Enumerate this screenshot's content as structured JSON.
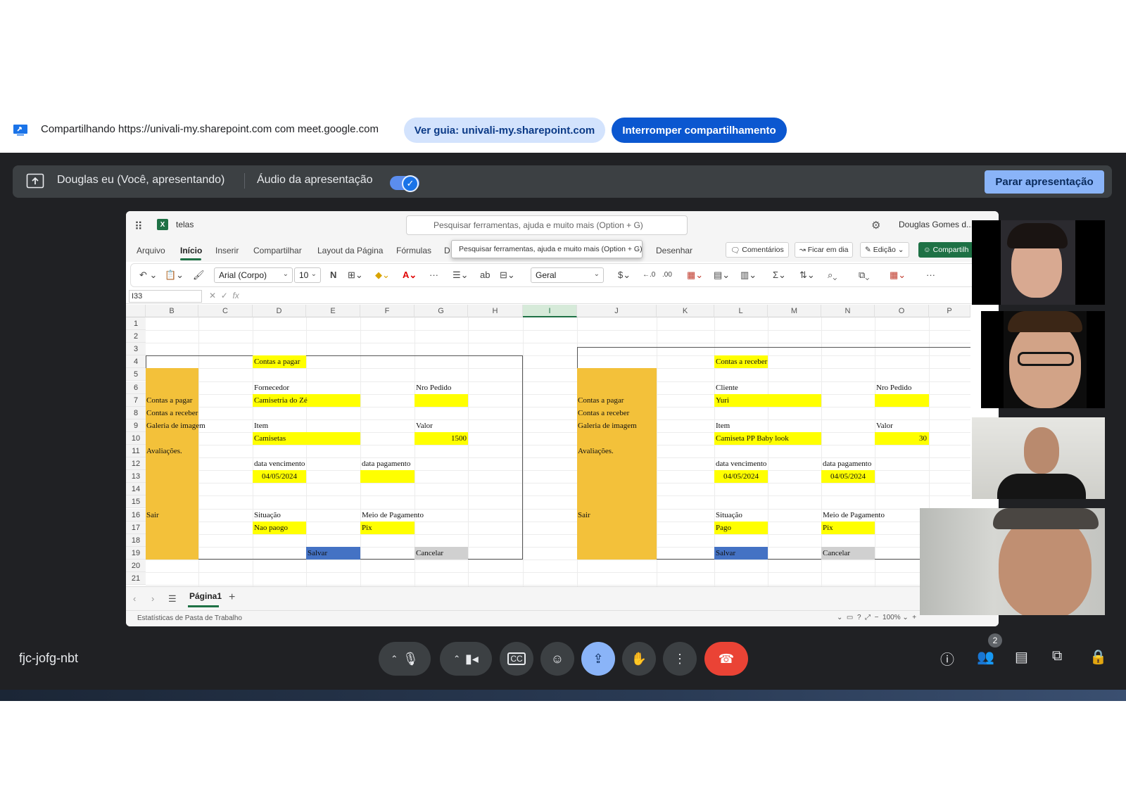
{
  "share_bar": {
    "text": "Compartilhando https://univali-my.sharepoint.com com meet.google.com",
    "guide_button": "Ver guia: univali-my.sharepoint.com",
    "stop_button": "Interromper compartilhamento"
  },
  "present_bar": {
    "presenter": "Douglas eu (Você, apresentando)",
    "audio_label": "Áudio da apresentação",
    "audio_enabled": true,
    "stop_button": "Parar apresentação"
  },
  "excel": {
    "filename": "telas",
    "search_placeholder": "Pesquisar ferramentas, ajuda e muito mais (Option + G)",
    "user": "Douglas Gomes d...",
    "menu": [
      "Arquivo",
      "Início",
      "Inserir",
      "Compartilhar",
      "Layout da Página",
      "Fórmulas",
      "D",
      "Desenhar"
    ],
    "tooltip": "Pesquisar ferramentas, ajuda e muito mais (Option + G)",
    "pills": {
      "comments": "Comentários",
      "catchup": "Ficar em dia",
      "editing": "Edição",
      "share": "Compartilh"
    },
    "ribbon": {
      "font": "Arial (Corpo)",
      "size": "10",
      "bold": "N",
      "format": "Geral",
      "currency": "$"
    },
    "name_box": "I33",
    "columns": [
      "B",
      "C",
      "D",
      "E",
      "F",
      "G",
      "H",
      "I",
      "J",
      "K",
      "L",
      "M",
      "N",
      "O",
      "P"
    ],
    "rows": [
      "1",
      "2",
      "3",
      "4",
      "5",
      "6",
      "7",
      "8",
      "9",
      "10",
      "11",
      "12",
      "13",
      "14",
      "15",
      "16",
      "17",
      "18",
      "19",
      "20",
      "21"
    ],
    "left_form": {
      "title": "Contas a pagar",
      "menu": [
        "Contas a pagar",
        "Contas a receber",
        "Galeria de imagem",
        "Avaliações.",
        "Sair"
      ],
      "fornecedor_label": "Fornecedor",
      "fornecedor_value": "Camisetria do Zé",
      "pedido_label": "Nro Pedido",
      "item_label": "Item",
      "item_value": "Camisetas",
      "valor_label": "Valor",
      "valor_value": "1500",
      "venc_label": "data vencimento",
      "venc_value": "04/05/2024",
      "pag_label": "data pagamento",
      "situacao_label": "Situação",
      "situacao_value": "Nao paogo",
      "meio_label": "Meio de Pagamento",
      "meio_value": "Pix",
      "save": "Salvar",
      "cancel": "Cancelar"
    },
    "right_form": {
      "title": "Contas a receber",
      "menu": [
        "Contas a pagar",
        "Contas a receber",
        "Galeria de imagem",
        "Avaliações.",
        "Sair"
      ],
      "cliente_label": "Cliente",
      "cliente_value": "Yuri",
      "pedido_label": "Nro Pedido",
      "item_label": "Item",
      "item_value": "Camiseta PP Baby look",
      "valor_label": "Valor",
      "valor_value": "30",
      "venc_label": "data vencimento",
      "venc_value": "04/05/2024",
      "pag_label": "data pagamento",
      "pag_value": "04/05/2024",
      "situacao_label": "Situação",
      "situacao_value": "Pago",
      "meio_label": "Meio de Pagamento",
      "meio_value": "Pix",
      "save": "Salvar",
      "cancel": "Cancelar"
    },
    "sheet_tab": "Página1",
    "status": "Estatísticas de Pasta de Trabalho",
    "zoom": "100%"
  },
  "meeting": {
    "code": "fjc-jofg-nbt",
    "participants_count": "2"
  },
  "colors": {
    "meet_bg": "#202124",
    "accent_blue": "#8ab4f8",
    "end_call": "#ea4335",
    "excel_green": "#1e7145",
    "cell_yellow": "#ffff00",
    "cell_orange": "#f3c13a",
    "cell_blue": "#4472c4"
  }
}
